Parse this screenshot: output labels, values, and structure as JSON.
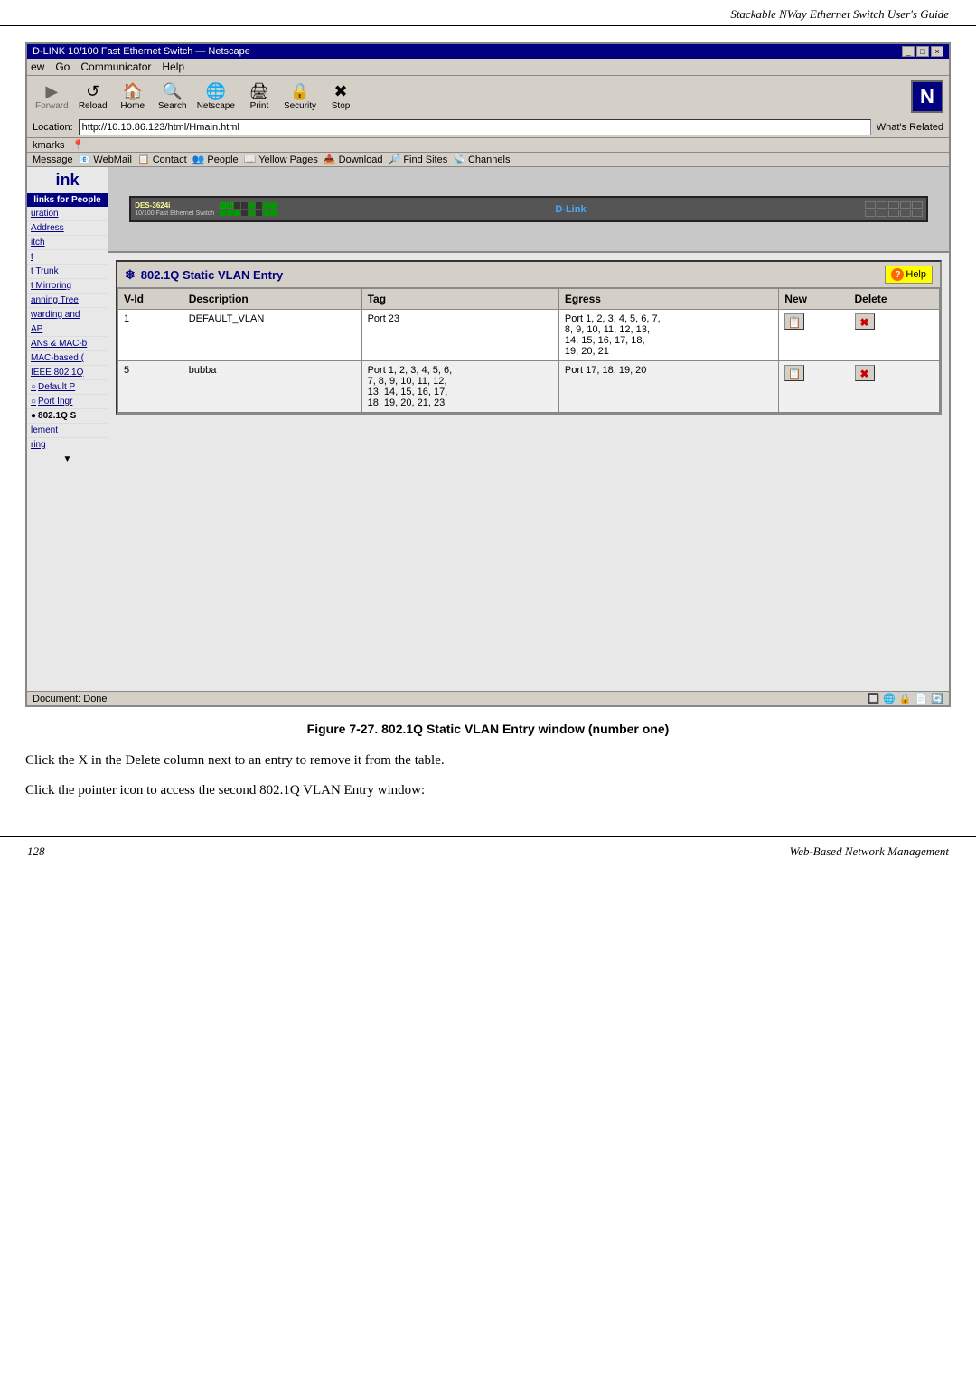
{
  "page": {
    "header_title": "Stackable NWay Ethernet Switch User's Guide",
    "footer_left": "128",
    "footer_right": "Web-Based Network Management"
  },
  "browser": {
    "titlebar": "D-LINK 10/100 Fast Ethernet Switch — Netscape",
    "titlebar_buttons": [
      "_",
      "□",
      "×"
    ],
    "menubar": [
      "ew",
      "Go",
      "Communicator",
      "Help"
    ],
    "toolbar_buttons": [
      {
        "label": "Forward",
        "icon": "▶",
        "disabled": true
      },
      {
        "label": "Reload",
        "icon": "↺"
      },
      {
        "label": "Home",
        "icon": "🏠"
      },
      {
        "label": "Search",
        "icon": "🔍"
      },
      {
        "label": "Netscape",
        "icon": "🌐"
      },
      {
        "label": "Print",
        "icon": "🖨"
      },
      {
        "label": "Security",
        "icon": "🔒"
      },
      {
        "label": "Stop",
        "icon": "✖"
      }
    ],
    "netscape_logo": "N",
    "location_label": "Location:",
    "location_url": "http://10.10.86.123/html/Hmain.html",
    "whats_related": "What's Related",
    "bookmarks_label": "kmarks",
    "bookmarks": [],
    "navtabs": [
      "Message",
      "WebMail",
      "Contact",
      "People",
      "Yellow Pages",
      "Download",
      "Find Sites",
      "Channels"
    ],
    "status_text": "Document: Done"
  },
  "sidebar": {
    "header": "links for People",
    "items": [
      {
        "label": "uration",
        "selected": false
      },
      {
        "label": "Address",
        "selected": false
      },
      {
        "label": "itch",
        "selected": false
      },
      {
        "label": "t",
        "selected": false
      },
      {
        "label": "t Trunk",
        "selected": false
      },
      {
        "label": "t Mirroring",
        "selected": false
      },
      {
        "label": "anning Tree",
        "selected": false
      },
      {
        "label": "warding and",
        "selected": false
      },
      {
        "label": "AP",
        "selected": false
      },
      {
        "label": "ANs & MAC-b",
        "selected": false
      },
      {
        "label": "MAC-based (",
        "selected": false
      },
      {
        "label": "IEEE 802.1Q",
        "selected": false
      },
      {
        "label": "Default P",
        "selected": false,
        "radio": true
      },
      {
        "label": "Port Ingr",
        "selected": false,
        "radio": true
      },
      {
        "label": "802.1Q S",
        "selected": true,
        "radio": true
      },
      {
        "label": "lement",
        "selected": false
      },
      {
        "label": "ring",
        "selected": false
      }
    ]
  },
  "vlan_panel": {
    "title": "802.1Q Static VLAN Entry",
    "title_icon": "❄",
    "help_label": "Help",
    "help_icon": "?",
    "table": {
      "columns": [
        "V-Id",
        "Description",
        "Tag",
        "Egress",
        "New",
        "Delete"
      ],
      "rows": [
        {
          "vid": "1",
          "description": "DEFAULT_VLAN",
          "tag": "Port 23",
          "egress": "Port 1, 2, 3, 4, 5, 6, 7, 8, 9, 10, 11, 12, 13, 14, 15, 16, 17, 18, 19, 20, 21",
          "has_new": true,
          "has_delete": true
        },
        {
          "vid": "5",
          "description": "bubba",
          "tag": "Port 1, 2, 3, 4, 5, 6, 7, 8, 9, 10, 11, 12, 13, 14, 15, 16, 17, 18, 19, 20, 21, 23",
          "egress": "Port 17, 18, 19, 20",
          "has_new": true,
          "has_delete": true
        }
      ]
    }
  },
  "figure": {
    "caption": "Figure 7-27.  802.1Q Static VLAN Entry window (number one)"
  },
  "body_paragraphs": [
    "Click the X in the Delete column next to an entry to remove it from the table.",
    "Click the pointer icon to access the second 802.1Q VLAN Entry window:"
  ]
}
